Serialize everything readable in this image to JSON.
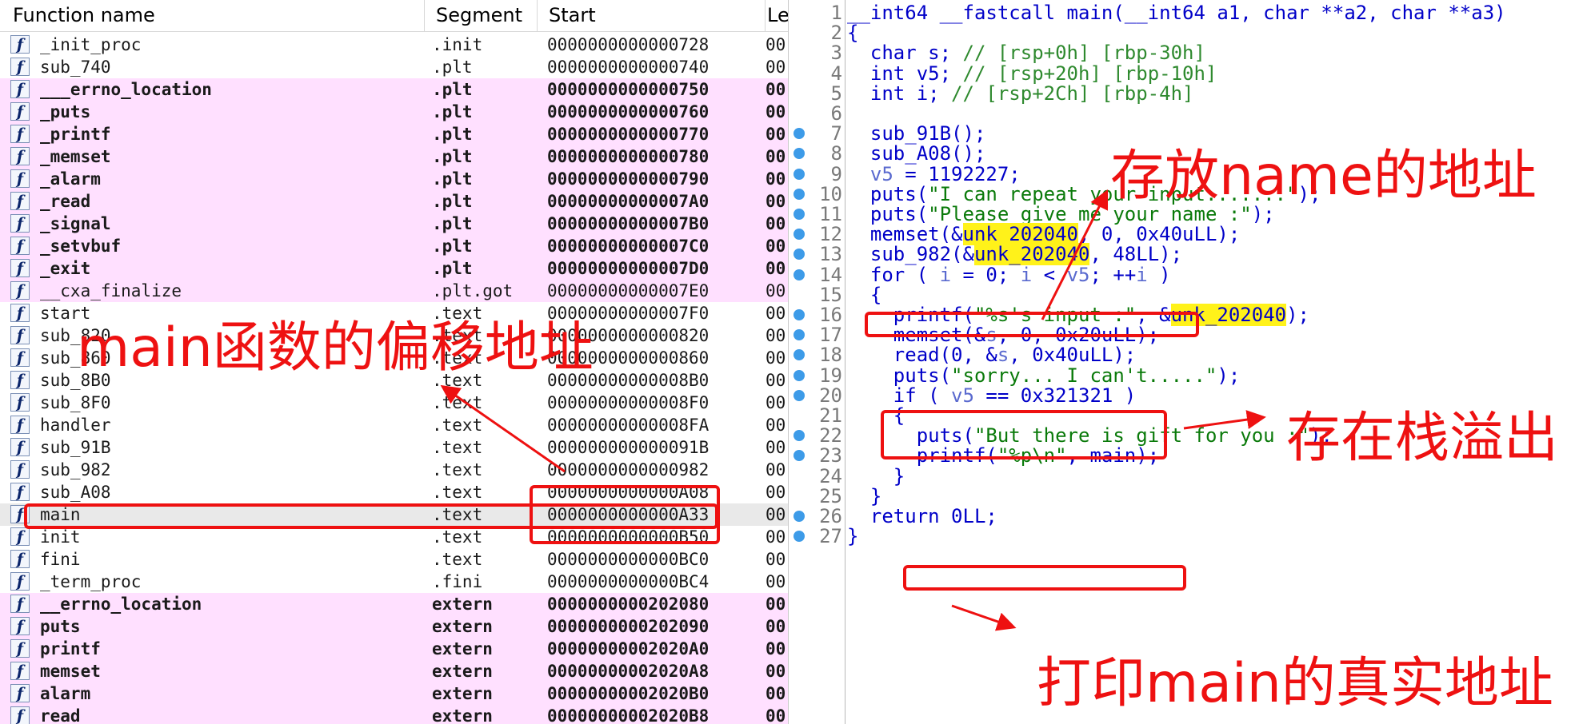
{
  "functions_window": {
    "headers": {
      "name": "Function name",
      "segment": "Segment",
      "start": "Start",
      "length": "Le"
    },
    "icon": "function-f-icon",
    "rows": [
      {
        "name": "_init_proc",
        "segment": ".init",
        "start": "0000000000000728",
        "len": "00",
        "style": "plain"
      },
      {
        "name": "sub_740",
        "segment": ".plt",
        "start": "0000000000000740",
        "len": "00",
        "style": "plain"
      },
      {
        "name": "___errno_location",
        "segment": ".plt",
        "start": "0000000000000750",
        "len": "00",
        "style": "import"
      },
      {
        "name": "_puts",
        "segment": ".plt",
        "start": "0000000000000760",
        "len": "00",
        "style": "import"
      },
      {
        "name": "_printf",
        "segment": ".plt",
        "start": "0000000000000770",
        "len": "00",
        "style": "import"
      },
      {
        "name": "_memset",
        "segment": ".plt",
        "start": "0000000000000780",
        "len": "00",
        "style": "import"
      },
      {
        "name": "_alarm",
        "segment": ".plt",
        "start": "0000000000000790",
        "len": "00",
        "style": "import"
      },
      {
        "name": "_read",
        "segment": ".plt",
        "start": "00000000000007A0",
        "len": "00",
        "style": "import"
      },
      {
        "name": "_signal",
        "segment": ".plt",
        "start": "00000000000007B0",
        "len": "00",
        "style": "import"
      },
      {
        "name": "_setvbuf",
        "segment": ".plt",
        "start": "00000000000007C0",
        "len": "00",
        "style": "import"
      },
      {
        "name": "_exit",
        "segment": ".plt",
        "start": "00000000000007D0",
        "len": "00",
        "style": "import"
      },
      {
        "name": "__cxa_finalize",
        "segment": ".plt.got",
        "start": "00000000000007E0",
        "len": "00",
        "style": "pink"
      },
      {
        "name": "start",
        "segment": ".text",
        "start": "00000000000007F0",
        "len": "00",
        "style": "plain"
      },
      {
        "name": "sub_820",
        "segment": ".text",
        "start": "0000000000000820",
        "len": "00",
        "style": "plain"
      },
      {
        "name": "sub_860",
        "segment": ".text",
        "start": "0000000000000860",
        "len": "00",
        "style": "plain"
      },
      {
        "name": "sub_8B0",
        "segment": ".text",
        "start": "00000000000008B0",
        "len": "00",
        "style": "plain"
      },
      {
        "name": "sub_8F0",
        "segment": ".text",
        "start": "00000000000008F0",
        "len": "00",
        "style": "plain"
      },
      {
        "name": "handler",
        "segment": ".text",
        "start": "00000000000008FA",
        "len": "00",
        "style": "plain"
      },
      {
        "name": "sub_91B",
        "segment": ".text",
        "start": "000000000000091B",
        "len": "00",
        "style": "plain"
      },
      {
        "name": "sub_982",
        "segment": ".text",
        "start": "0000000000000982",
        "len": "00",
        "style": "plain"
      },
      {
        "name": "sub_A08",
        "segment": ".text",
        "start": "0000000000000A08",
        "len": "00",
        "style": "plain"
      },
      {
        "name": "main",
        "segment": ".text",
        "start": "0000000000000A33",
        "len": "00",
        "style": "selected"
      },
      {
        "name": "init",
        "segment": ".text",
        "start": "0000000000000B50",
        "len": "00",
        "style": "plain"
      },
      {
        "name": "fini",
        "segment": ".text",
        "start": "0000000000000BC0",
        "len": "00",
        "style": "plain"
      },
      {
        "name": "_term_proc",
        "segment": ".fini",
        "start": "0000000000000BC4",
        "len": "00",
        "style": "plain"
      },
      {
        "name": "__errno_location",
        "segment": "extern",
        "start": "0000000000202080",
        "len": "00",
        "style": "import"
      },
      {
        "name": "puts",
        "segment": "extern",
        "start": "0000000000202090",
        "len": "00",
        "style": "import"
      },
      {
        "name": "printf",
        "segment": "extern",
        "start": "00000000002020A0",
        "len": "00",
        "style": "import"
      },
      {
        "name": "memset",
        "segment": "extern",
        "start": "00000000002020A8",
        "len": "00",
        "style": "import"
      },
      {
        "name": "alarm",
        "segment": "extern",
        "start": "00000000002020B0",
        "len": "00",
        "style": "import"
      },
      {
        "name": "read",
        "segment": "extern",
        "start": "00000000002020B8",
        "len": "00",
        "style": "import"
      }
    ]
  },
  "pseudocode": {
    "breakpoint_icon": "breakpoint-dot-icon",
    "lines": [
      {
        "n": "1",
        "bp": false,
        "parts": [
          [
            "__int64 __fastcall main(__int64 a1, char **a2, char **a3)",
            "plain"
          ]
        ]
      },
      {
        "n": "2",
        "bp": false,
        "parts": [
          [
            "{",
            "plain"
          ]
        ]
      },
      {
        "n": "3",
        "bp": false,
        "parts": [
          [
            "  char s; ",
            "plain"
          ],
          [
            "// [rsp+0h] [rbp-30h]",
            "cm"
          ]
        ]
      },
      {
        "n": "4",
        "bp": false,
        "parts": [
          [
            "  int v5; ",
            "plain"
          ],
          [
            "// [rsp+20h] [rbp-10h]",
            "cm"
          ]
        ]
      },
      {
        "n": "5",
        "bp": false,
        "parts": [
          [
            "  int i; ",
            "plain"
          ],
          [
            "// [rsp+2Ch] [rbp-4h]",
            "cm"
          ]
        ]
      },
      {
        "n": "6",
        "bp": false,
        "parts": [
          [
            "",
            "plain"
          ]
        ]
      },
      {
        "n": "7",
        "bp": true,
        "parts": [
          [
            "  sub_91B();",
            "plain"
          ]
        ]
      },
      {
        "n": "8",
        "bp": true,
        "parts": [
          [
            "  sub_A08();",
            "plain"
          ]
        ]
      },
      {
        "n": "9",
        "bp": true,
        "parts": [
          [
            "  ",
            "plain"
          ],
          [
            "v5",
            "var"
          ],
          [
            " = 1192227;",
            "plain"
          ]
        ]
      },
      {
        "n": "10",
        "bp": true,
        "parts": [
          [
            "  puts(",
            "plain"
          ],
          [
            "\"I can repeat your input.......\"",
            "str"
          ],
          [
            ");",
            "plain"
          ]
        ]
      },
      {
        "n": "11",
        "bp": true,
        "parts": [
          [
            "  puts(",
            "plain"
          ],
          [
            "\"Please give me your name :\"",
            "str"
          ],
          [
            ");",
            "plain"
          ]
        ]
      },
      {
        "n": "12",
        "bp": true,
        "parts": [
          [
            "  memset(&",
            "plain"
          ],
          [
            "unk_202040",
            "hl"
          ],
          [
            ", 0, 0x40uLL);",
            "plain"
          ]
        ]
      },
      {
        "n": "13",
        "bp": true,
        "parts": [
          [
            "  sub_982(&",
            "plain"
          ],
          [
            "unk_202040",
            "hl"
          ],
          [
            ", 48LL);",
            "plain"
          ]
        ]
      },
      {
        "n": "14",
        "bp": true,
        "parts": [
          [
            "  for ( ",
            "plain"
          ],
          [
            "i",
            "var"
          ],
          [
            " = 0; ",
            "plain"
          ],
          [
            "i",
            "var"
          ],
          [
            " < ",
            "plain"
          ],
          [
            "v5",
            "var"
          ],
          [
            "; ++",
            "plain"
          ],
          [
            "i",
            "var"
          ],
          [
            " )",
            "plain"
          ]
        ]
      },
      {
        "n": "15",
        "bp": false,
        "parts": [
          [
            "  {",
            "plain"
          ]
        ]
      },
      {
        "n": "16",
        "bp": true,
        "parts": [
          [
            "    printf(",
            "plain"
          ],
          [
            "\"%s's input :\"",
            "str"
          ],
          [
            ", &",
            "plain"
          ],
          [
            "unk_202040",
            "hl"
          ],
          [
            ");",
            "plain"
          ]
        ]
      },
      {
        "n": "17",
        "bp": true,
        "parts": [
          [
            "    memset(&",
            "plain"
          ],
          [
            "s",
            "var"
          ],
          [
            ", 0, 0x20uLL);",
            "plain"
          ]
        ]
      },
      {
        "n": "18",
        "bp": true,
        "parts": [
          [
            "    read(0, &",
            "plain"
          ],
          [
            "s",
            "var"
          ],
          [
            ", 0x40uLL);",
            "plain"
          ]
        ]
      },
      {
        "n": "19",
        "bp": true,
        "parts": [
          [
            "    puts(",
            "plain"
          ],
          [
            "\"sorry... I can't.....\"",
            "str"
          ],
          [
            ");",
            "plain"
          ]
        ]
      },
      {
        "n": "20",
        "bp": true,
        "parts": [
          [
            "    if ( ",
            "plain"
          ],
          [
            "v5",
            "var"
          ],
          [
            " == 0x321321 )",
            "plain"
          ]
        ]
      },
      {
        "n": "21",
        "bp": false,
        "parts": [
          [
            "    {",
            "plain"
          ]
        ]
      },
      {
        "n": "22",
        "bp": true,
        "parts": [
          [
            "      puts(",
            "plain"
          ],
          [
            "\"But there is gift for you :\"",
            "str"
          ],
          [
            ");",
            "plain"
          ]
        ]
      },
      {
        "n": "23",
        "bp": true,
        "parts": [
          [
            "      printf(",
            "plain"
          ],
          [
            "\"%p\\n\"",
            "str"
          ],
          [
            ", main);",
            "plain"
          ]
        ]
      },
      {
        "n": "24",
        "bp": false,
        "parts": [
          [
            "    }",
            "plain"
          ]
        ]
      },
      {
        "n": "25",
        "bp": false,
        "parts": [
          [
            "  }",
            "plain"
          ]
        ]
      },
      {
        "n": "26",
        "bp": true,
        "parts": [
          [
            "  return 0LL;",
            "plain"
          ]
        ]
      },
      {
        "n": "27",
        "bp": true,
        "parts": [
          [
            "}",
            "plain"
          ]
        ]
      }
    ]
  },
  "annotations": {
    "main_offset": "main函数的偏移地址",
    "name_address": "存放name的地址",
    "stack_overflow": "存在栈溢出",
    "print_main": "打印main的真实地址",
    "color": "#ee1111"
  }
}
